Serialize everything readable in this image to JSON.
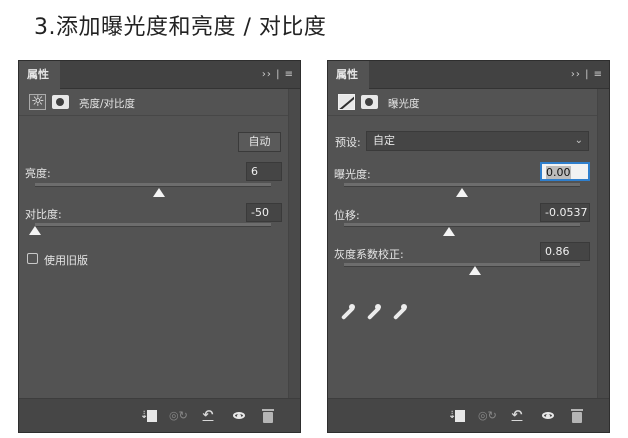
{
  "heading": "3.添加曝光度和亮度 / 对比度",
  "left_panel": {
    "tab": "属性",
    "menu": "›› | ≡",
    "adjustment_label": "亮度/对比度",
    "auto_button": "自动",
    "brightness": {
      "label": "亮度:",
      "value": "6",
      "slider_level": 0.51
    },
    "contrast": {
      "label": "对比度:",
      "value": "-50",
      "slider_level": 0.0
    },
    "legacy_label": "使用旧版",
    "icons": [
      "clip-to-layer-icon",
      "view-previous-state-icon",
      "reset-icon",
      "visibility-eye-icon",
      "delete-trash-icon"
    ]
  },
  "right_panel": {
    "tab": "属性",
    "menu": "›› | ≡",
    "adjustment_label": "曝光度",
    "preset_label": "预设:",
    "preset_value": "自定",
    "exposure": {
      "label": "曝光度:",
      "value": "0.00",
      "slider_level": 0.5
    },
    "offset": {
      "label": "位移:",
      "value": "-0.0537",
      "slider_level": 0.44
    },
    "gamma": {
      "label": "灰度系数校正:",
      "value": "0.86",
      "slider_level": 0.55
    },
    "icons": [
      "black-point-eyedropper-icon",
      "gray-point-eyedropper-icon",
      "white-point-eyedropper-icon"
    ]
  }
}
